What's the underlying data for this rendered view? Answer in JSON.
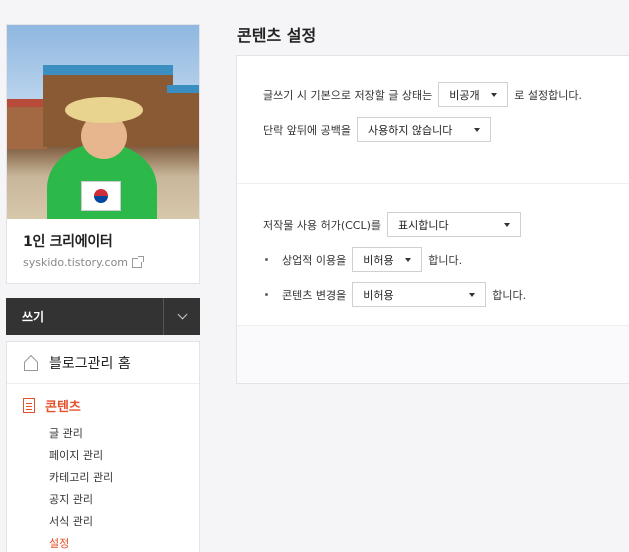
{
  "sidebar": {
    "blog_name": "1인 크리에이터",
    "blog_url": "syskido.tistory.com",
    "write_label": "쓰기",
    "home_label": "블로그관리 홈",
    "content_section": {
      "title": "콘텐츠",
      "items": [
        "글 관리",
        "페이지 관리",
        "카테고리 관리",
        "공지 관리",
        "서식 관리",
        "설정"
      ],
      "active_item": "설정"
    }
  },
  "main": {
    "title": "콘텐츠 설정",
    "default_status": {
      "prefix": "글쓰기 시 기본으로 저장할 글 상태는",
      "value": "비공개",
      "suffix": "로 설정합니다."
    },
    "paragraph_spacing": {
      "label": "단락 앞뒤에 공백을",
      "value": "사용하지 않습니다"
    },
    "ccl": {
      "label": "저작물 사용 허가(CCL)를",
      "value": "표시합니다"
    },
    "commercial": {
      "label": "상업적 이용을",
      "value": "비허용",
      "suffix": "합니다."
    },
    "modification": {
      "label": "콘텐츠 변경을",
      "value": "비허용",
      "suffix": "합니다."
    }
  },
  "colors": {
    "accent": "#e5502c",
    "dark_bar": "#333333"
  }
}
